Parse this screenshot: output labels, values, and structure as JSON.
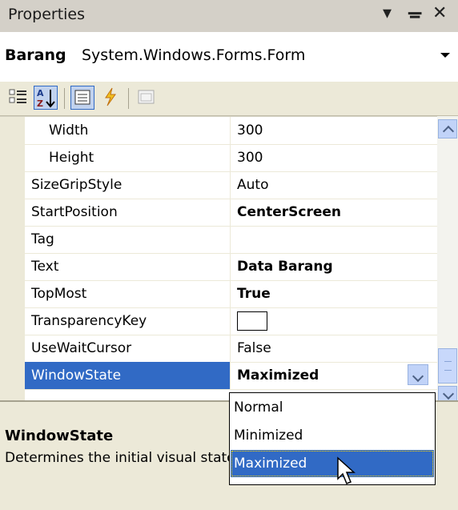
{
  "window": {
    "title": "Properties"
  },
  "object_selector": {
    "name": "Barang",
    "type": "System.Windows.Forms.Form"
  },
  "toolbar": {
    "icons": [
      "categorized-icon",
      "alphabetical-icon",
      "properties-icon",
      "events-icon",
      "property-pages-icon"
    ]
  },
  "properties": [
    {
      "name": "Width",
      "value": "300",
      "bold": false,
      "indent": true
    },
    {
      "name": "Height",
      "value": "300",
      "bold": false,
      "indent": true
    },
    {
      "name": "SizeGripStyle",
      "value": "Auto",
      "bold": false
    },
    {
      "name": "StartPosition",
      "value": "CenterScreen",
      "bold": true
    },
    {
      "name": "Tag",
      "value": "",
      "bold": false
    },
    {
      "name": "Text",
      "value": "Data Barang",
      "bold": true
    },
    {
      "name": "TopMost",
      "value": "True",
      "bold": true
    },
    {
      "name": "TransparencyKey",
      "value": "",
      "bold": false,
      "swatch": true
    },
    {
      "name": "UseWaitCursor",
      "value": "False",
      "bold": false
    },
    {
      "name": "WindowState",
      "value": "Maximized",
      "bold": true,
      "selected": true
    }
  ],
  "dropdown": {
    "options": [
      "Normal",
      "Minimized",
      "Maximized"
    ],
    "selected": "Maximized"
  },
  "description": {
    "title": "WindowState",
    "text": "Determines the initial visual state of the form."
  },
  "colors": {
    "selection": "#316ac5",
    "panel": "#ece9d8"
  }
}
